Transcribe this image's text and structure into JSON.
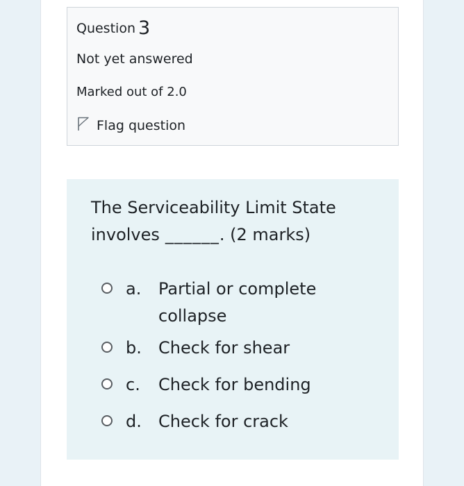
{
  "question_info": {
    "label": "Question",
    "number": "3",
    "state": "Not yet answered",
    "grade": "Marked out of 2.0",
    "flag_label": "Flag question",
    "flag_icon": "flag-icon"
  },
  "question": {
    "text": "The Serviceability Limit State involves",
    "blank": "______",
    "suffix": ". (2 marks)",
    "options": [
      {
        "letter": "a.",
        "text": "Partial or complete collapse",
        "selected": false
      },
      {
        "letter": "b.",
        "text": "Check for shear",
        "selected": false
      },
      {
        "letter": "c.",
        "text": "Check for bending",
        "selected": false
      },
      {
        "letter": "d.",
        "text": "Check for crack",
        "selected": false
      }
    ]
  },
  "colors": {
    "page_bg": "#e9f2f7",
    "info_bg": "#f8f9fa",
    "content_bg": "#e8f3f6",
    "text": "#1d2125"
  }
}
